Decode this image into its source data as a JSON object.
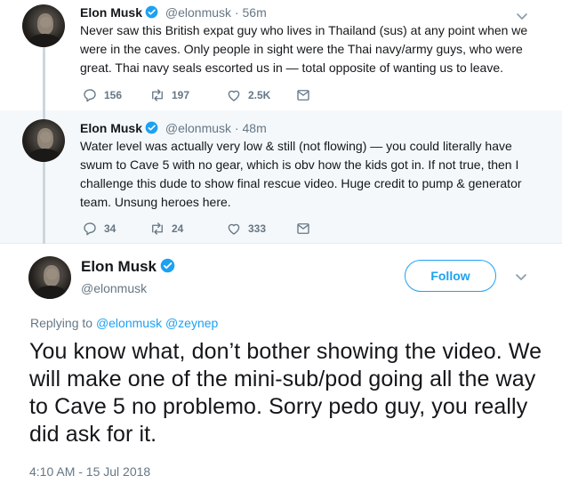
{
  "tweet1": {
    "name": "Elon Musk",
    "handle": "@elonmusk",
    "dot": "·",
    "time": "56m",
    "text": "Never saw this British expat guy who lives in Thailand (sus) at any point when we were in the caves. Only people in sight were the Thai navy/army guys, who were great. Thai navy seals escorted us in — total opposite of wanting us to leave.",
    "replies": "156",
    "retweets": "197",
    "likes": "2.5K"
  },
  "tweet2": {
    "name": "Elon Musk",
    "handle": "@elonmusk",
    "dot": "·",
    "time": "48m",
    "text": "Water level was actually very low & still (not flowing) — you could literally have swum to Cave 5 with no gear, which is obv how the kids got in. If not true, then I challenge this dude to show final rescue video. Huge credit to pump & generator team. Unsung heroes here.",
    "replies": "34",
    "retweets": "24",
    "likes": "333"
  },
  "main": {
    "name": "Elon Musk",
    "handle": "@elonmusk",
    "follow_label": "Follow",
    "replying_prefix": "Replying to",
    "replying_to_1": "@elonmusk",
    "replying_to_2": "@zeynep",
    "text": "You know what, don’t bother showing the video. We will make one of the mini-sub/pod going all the way to Cave 5 no problemo. Sorry pedo guy, you really did ask for it.",
    "timestamp": "4:10 AM - 15 Jul 2018"
  },
  "colors": {
    "accent": "#1da1f2",
    "muted": "#657786",
    "text": "#14171a",
    "highlight_bg": "#f5f8fa"
  },
  "icons": [
    "verified-badge-icon",
    "chevron-down-icon",
    "reply-icon",
    "retweet-icon",
    "like-icon",
    "direct-message-icon"
  ]
}
